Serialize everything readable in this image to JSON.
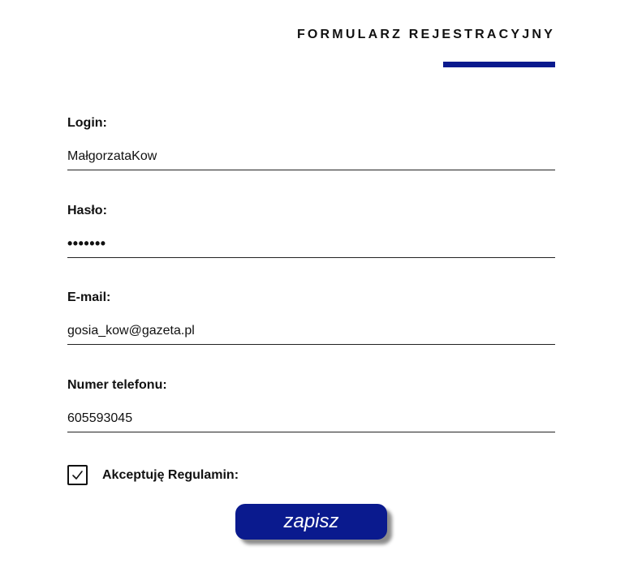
{
  "form": {
    "title": "FORMULARZ REJESTRACYJNY",
    "accent_color": "#0a1a8e",
    "fields": [
      {
        "label": "Login:",
        "value": "MałgorzataKow"
      },
      {
        "label": "Hasło:",
        "value": "•••••••"
      },
      {
        "label": "E-mail:",
        "value": "gosia_kow@gazeta.pl"
      },
      {
        "label": "Numer telefonu:",
        "value": "605593045"
      }
    ],
    "consent": {
      "label": "Akceptuję Regulamin:",
      "checked": true
    },
    "submit_label": "zapisz"
  }
}
